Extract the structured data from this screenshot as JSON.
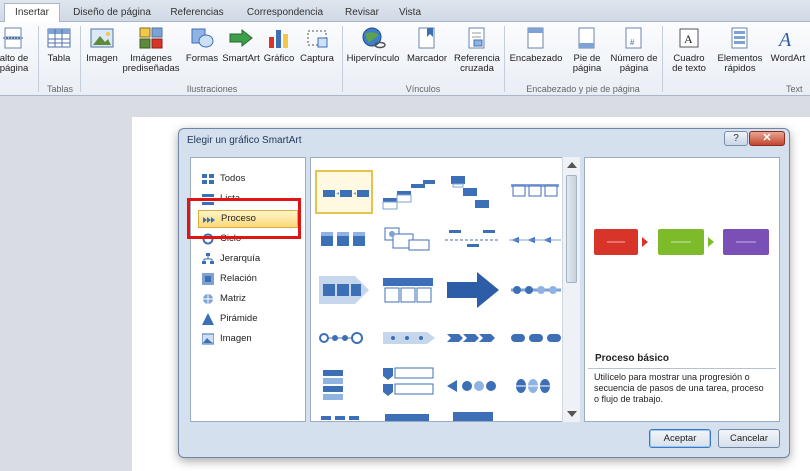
{
  "ribbon": {
    "tabs": [
      "Insertar",
      "Diseño de página",
      "Referencias",
      "Correspondencia",
      "Revisar",
      "Vista"
    ],
    "buttons": {
      "salto": "alto de\npágina",
      "tabla": "Tabla",
      "imagen": "Imagen",
      "imagenes_pred": "Imágenes\nprediseñadas",
      "formas": "Formas",
      "smartart": "SmartArt",
      "grafico": "Gráfico",
      "captura": "Captura",
      "hipervinculo": "Hipervínculo",
      "marcador": "Marcador",
      "referencia": "Referencia\ncruzada",
      "encabezado": "Encabezado",
      "pie": "Pie de\npágina",
      "numero": "Número de\npágina",
      "cuadro": "Cuadro\nde texto",
      "elementos": "Elementos\nrápidos",
      "wordart": "WordArt"
    },
    "groups": {
      "tablas": "Tablas",
      "ilustraciones": "Ilustraciones",
      "vinculos": "Vínculos",
      "encabezado": "Encabezado y pie de página",
      "texto": "Text"
    }
  },
  "dialog": {
    "title": "Elegir un gráfico SmartArt",
    "help": "?",
    "close": "✕",
    "categories": [
      {
        "label": "Todos",
        "icon": "all-icon"
      },
      {
        "label": "Lista",
        "icon": "list-icon"
      },
      {
        "label": "Proceso",
        "icon": "process-icon"
      },
      {
        "label": "Ciclo",
        "icon": "cycle-icon"
      },
      {
        "label": "Jerarquía",
        "icon": "hierarchy-icon"
      },
      {
        "label": "Relación",
        "icon": "relation-icon"
      },
      {
        "label": "Matriz",
        "icon": "matrix-icon"
      },
      {
        "label": "Pirámide",
        "icon": "pyramid-icon"
      },
      {
        "label": "Imagen",
        "icon": "image-icon"
      }
    ],
    "selected_category": "Proceso",
    "preview_title": "Proceso básico",
    "preview_desc": "Utilícelo para mostrar una progresión o secuencia de pasos de una tarea, proceso o flujo de trabajo.",
    "accept": "Aceptar",
    "cancel": "Cancelar",
    "colors": {
      "red": "#d8352a",
      "green": "#7dbb2a",
      "purple": "#7a4fb6",
      "blue": "#3d6fb6",
      "accent": "#2e5da8"
    }
  }
}
